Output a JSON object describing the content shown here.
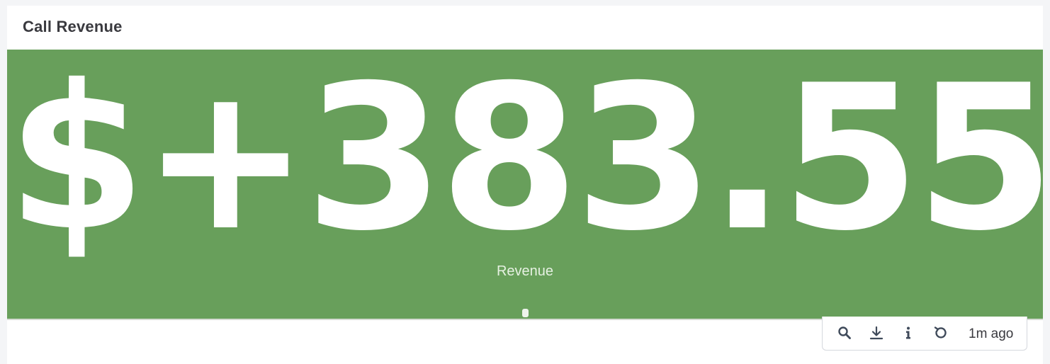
{
  "panel": {
    "title": "Call Revenue",
    "background_color": "#689f5b",
    "value": "$+383.55",
    "label": "Revenue"
  },
  "toolbar": {
    "buttons": [
      {
        "icon": "search-icon"
      },
      {
        "icon": "download-icon"
      },
      {
        "icon": "info-icon"
      },
      {
        "icon": "refresh-icon"
      }
    ],
    "updated": "1m ago"
  }
}
